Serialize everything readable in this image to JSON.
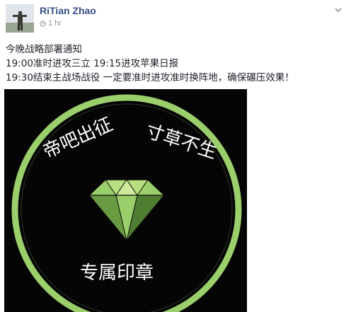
{
  "post": {
    "author": "RiTian Zhao",
    "time": "1 hr",
    "icons": {
      "avatar": "profile-photo",
      "clock": "clock-icon",
      "menu": "chevron-down-icon",
      "diamond": "diamond-icon"
    },
    "lines": [
      "今晚战略部署通知",
      "19:00准时进攻三立 19:15进攻苹果日报",
      "19:30结束主战场战役 一定要准时进攻准时换阵地，确保碾压效果！"
    ],
    "image": {
      "text_top_left": "帝吧出征",
      "text_top_right": "寸草不生",
      "text_bottom": "专属印章",
      "colors": {
        "background": "#050505",
        "ring": "#9bcf6b",
        "diamond_light": "#b8e07f",
        "diamond_mid": "#7fb24f",
        "diamond_dark": "#4f7d32",
        "text": "#ffffff"
      }
    }
  },
  "colors": {
    "author_link": "#364f85",
    "meta_text": "#90949c",
    "body_text": "#1d2129"
  }
}
